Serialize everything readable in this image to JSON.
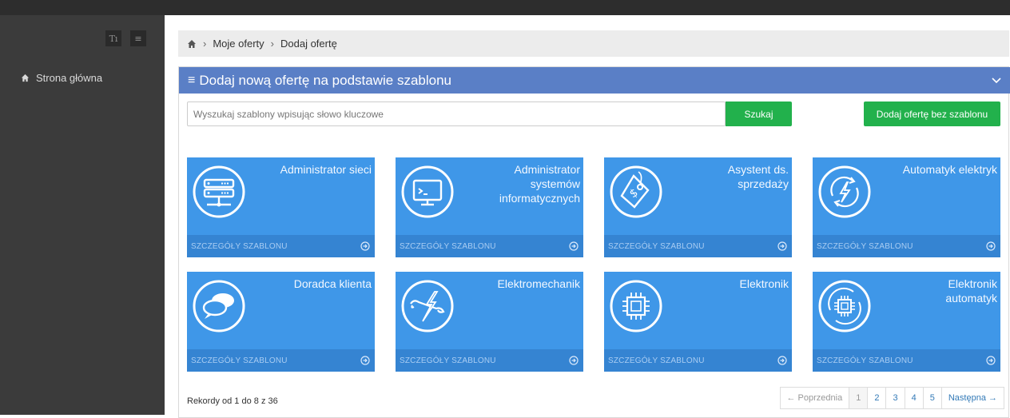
{
  "sidebar": {
    "font_button": "Tı",
    "menu_button": "≡",
    "items": [
      {
        "label": "Strona główna",
        "icon": "home-icon"
      }
    ]
  },
  "breadcrumb": {
    "home_icon": "home-icon",
    "items": [
      "Moje oferty",
      "Dodaj ofertę"
    ]
  },
  "panel": {
    "title": "Dodaj nową ofertę na podstawie szablonu",
    "search": {
      "placeholder": "Wyszukaj szablony wpisując słowo kluczowe",
      "value": "",
      "button": "Szukaj"
    },
    "add_without_template": "Dodaj ofertę bez szablonu",
    "cards": [
      {
        "title": "Administrator sieci",
        "icon": "server-icon",
        "footer": "SZCZEGÓŁY SZABLONU"
      },
      {
        "title": "Administrator systemów informatycznych",
        "icon": "monitor-terminal-icon",
        "footer": "SZCZEGÓŁY SZABLONU"
      },
      {
        "title": "Asystent ds. sprzedaży",
        "icon": "price-tag-icon",
        "footer": "SZCZEGÓŁY SZABLONU"
      },
      {
        "title": "Automatyk elektryk",
        "icon": "lightning-refresh-icon",
        "footer": "SZCZEGÓŁY SZABLONU"
      },
      {
        "title": "Doradca klienta",
        "icon": "chat-bubbles-icon",
        "footer": "SZCZEGÓŁY SZABLONU"
      },
      {
        "title": "Elektromechanik",
        "icon": "wrench-lightning-icon",
        "footer": "SZCZEGÓŁY SZABLONU"
      },
      {
        "title": "Elektronik",
        "icon": "chip-icon",
        "footer": "SZCZEGÓŁY SZABLONU"
      },
      {
        "title": "Elektronik automatyk",
        "icon": "chip-refresh-icon",
        "footer": "SZCZEGÓŁY SZABLONU"
      }
    ],
    "records": "Rekordy od 1 do 8 z 36",
    "pagination": {
      "prev": "← Poprzednia",
      "pages": [
        "1",
        "2",
        "3",
        "4",
        "5"
      ],
      "active_page": "1",
      "next": "Następna →"
    }
  },
  "colors": {
    "topbar": "#2d2d2d",
    "sidebar": "#3b3b3b",
    "panel_header": "#5a7fc6",
    "card": "#3f97e8",
    "card_footer": "#3584d2",
    "green_button": "#22b14c"
  }
}
